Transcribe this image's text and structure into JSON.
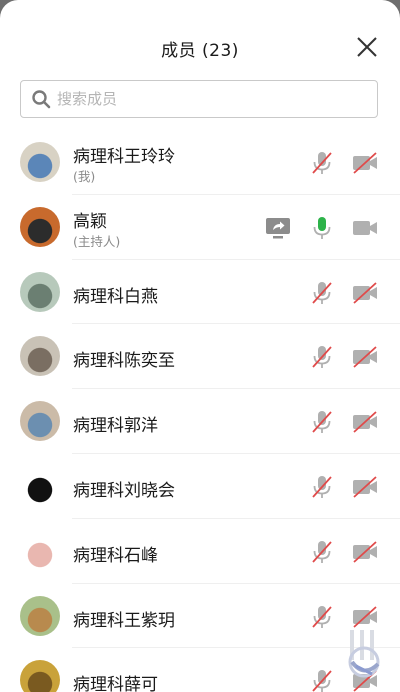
{
  "header": {
    "title": "成员 (23)"
  },
  "search": {
    "placeholder": "搜索成员"
  },
  "colors": {
    "mic_active": "#2db34a",
    "muted_slash": "#e04a4a",
    "icon_gray": "#b0b0b0"
  },
  "members": [
    {
      "name": "病理科王玲玲",
      "tag": "(我)",
      "mic": "muted",
      "camera": "off",
      "sharing": false,
      "avatar_colors": [
        "#d8d2c4",
        "#5b86b8"
      ]
    },
    {
      "name": "高颖",
      "tag": "(主持人)",
      "mic": "on",
      "camera": "on",
      "sharing": true,
      "avatar_colors": [
        "#c86a2d",
        "#2c2c2c"
      ]
    },
    {
      "name": "病理科白燕",
      "tag": "",
      "mic": "muted",
      "camera": "off",
      "sharing": false,
      "avatar_colors": [
        "#b7c9bb",
        "#6b7f72"
      ]
    },
    {
      "name": "病理科陈奕至",
      "tag": "",
      "mic": "muted",
      "camera": "off",
      "sharing": false,
      "avatar_colors": [
        "#c9c2b6",
        "#7a6e62"
      ]
    },
    {
      "name": "病理科郭洋",
      "tag": "",
      "mic": "muted",
      "camera": "off",
      "sharing": false,
      "avatar_colors": [
        "#cbbba8",
        "#6c8fb0"
      ]
    },
    {
      "name": "病理科刘晓会",
      "tag": "",
      "mic": "muted",
      "camera": "off",
      "sharing": false,
      "avatar_colors": [
        "#ffffff",
        "#111111"
      ]
    },
    {
      "name": "病理科石峰",
      "tag": "",
      "mic": "muted",
      "camera": "off",
      "sharing": false,
      "avatar_colors": [
        "#ffffff",
        "#e9b7b0"
      ]
    },
    {
      "name": "病理科王紫玥",
      "tag": "",
      "mic": "muted",
      "camera": "off",
      "sharing": false,
      "avatar_colors": [
        "#a9c08a",
        "#b88a4e"
      ]
    },
    {
      "name": "病理科薛可",
      "tag": "",
      "mic": "muted",
      "camera": "off",
      "sharing": false,
      "avatar_colors": [
        "#c9a23a",
        "#7a5a20"
      ]
    }
  ]
}
